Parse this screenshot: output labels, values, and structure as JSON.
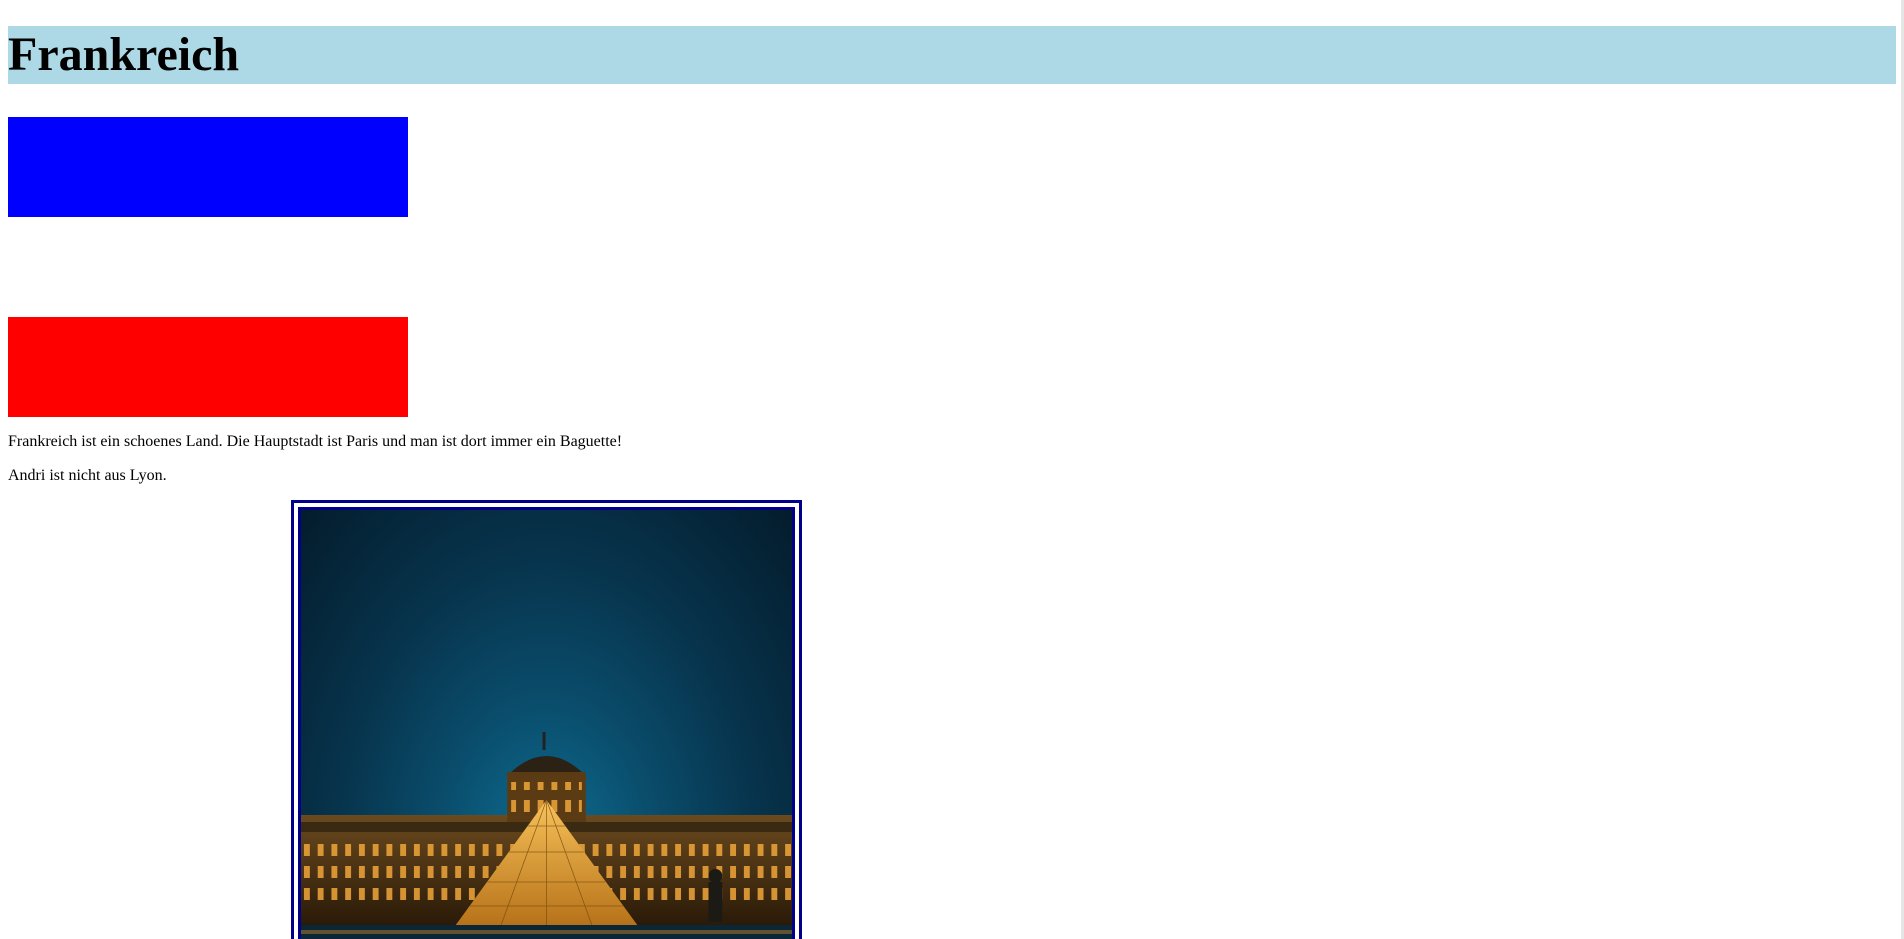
{
  "header": {
    "title": "Frankreich",
    "background_color": "#add8e6"
  },
  "flag": {
    "colors": [
      "#0000ff",
      "#ffffff",
      "#ff0000"
    ]
  },
  "content": {
    "paragraph_1": "Frankreich ist ein schoenes Land. Die Hauptstadt ist Paris und man ist dort immer ein Baguette!",
    "paragraph_2": "Andri ist nicht aus Lyon."
  },
  "image": {
    "subject": "Louvre pyramid at night",
    "border_color": "#00008b"
  }
}
